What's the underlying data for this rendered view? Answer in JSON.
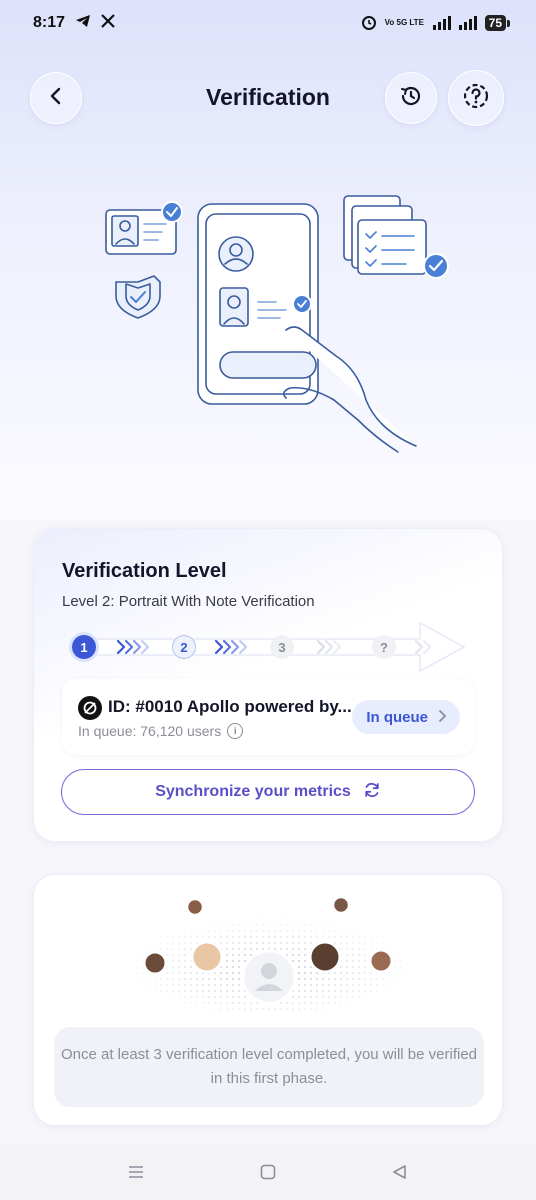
{
  "status_bar": {
    "time": "8:17",
    "network_label": "Vo 5G LTE",
    "battery": "75",
    "icons": [
      "telegram-icon",
      "x-icon",
      "alarm-icon",
      "signal-icon",
      "battery-icon"
    ]
  },
  "header": {
    "title": "Verification",
    "back_icon": "chevron-left-icon",
    "history_icon": "history-icon",
    "help_icon": "help-icon"
  },
  "verification_level": {
    "title": "Verification Level",
    "subtitle": "Level 2: Portrait With Note Verification",
    "steps": [
      {
        "label": "1",
        "state": "active"
      },
      {
        "label": "2",
        "state": "current"
      },
      {
        "label": "3",
        "state": "pending"
      },
      {
        "label": "?",
        "state": "pending"
      }
    ],
    "queue": {
      "title": "ID: #0010 Apollo powered by...",
      "subtitle": "In queue: 76,120 users",
      "status_button": "In queue"
    },
    "sync_button": "Synchronize your metrics"
  },
  "phase": {
    "note": "Once at least 3 verification level completed, you will be verified in this first phase."
  },
  "colors": {
    "accent": "#3b57d6",
    "sync": "#5b4fc7",
    "header_gradient_top": "#dde2fb"
  }
}
